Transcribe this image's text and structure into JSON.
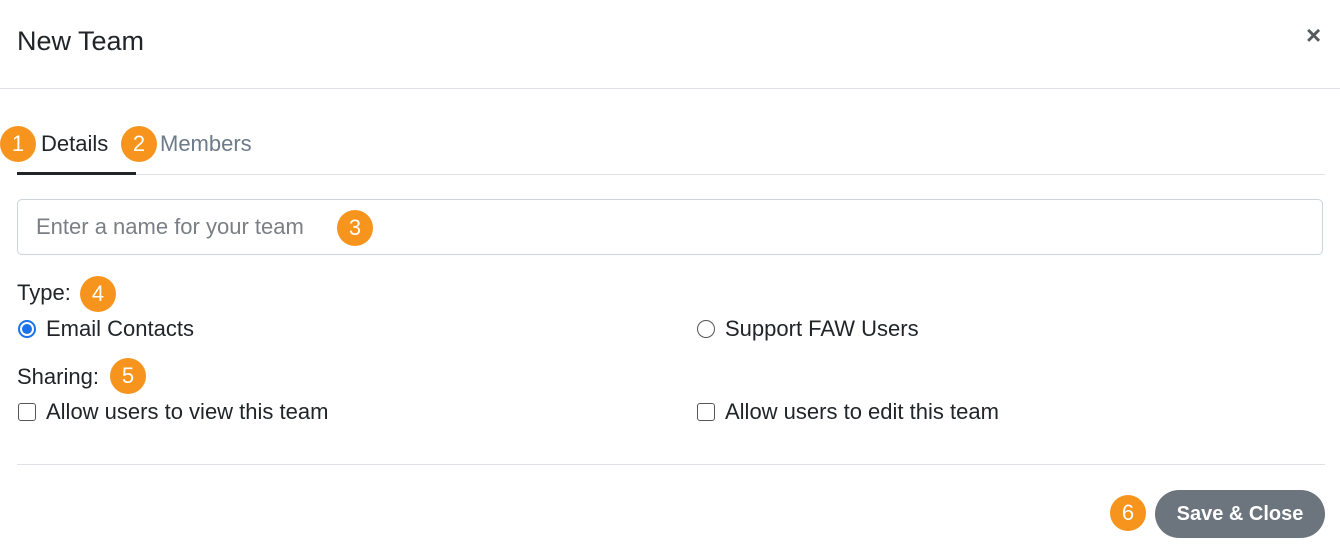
{
  "dialog": {
    "title": "New Team",
    "close_symbol": "×"
  },
  "tabs": [
    {
      "label": "Details",
      "active": true
    },
    {
      "label": "Members",
      "active": false
    }
  ],
  "name_input": {
    "placeholder": "Enter a name for your team",
    "value": ""
  },
  "type": {
    "label": "Type:",
    "options": [
      {
        "label": "Email Contacts",
        "selected": true
      },
      {
        "label": "Support FAW Users",
        "selected": false
      }
    ]
  },
  "sharing": {
    "label": "Sharing:",
    "options": [
      {
        "label": "Allow users to view this team",
        "checked": false
      },
      {
        "label": "Allow users to edit this team",
        "checked": false
      }
    ]
  },
  "footer": {
    "save_label": "Save & Close"
  },
  "markers": [
    "1",
    "2",
    "3",
    "4",
    "5",
    "6"
  ],
  "colors": {
    "marker": "#f7941d",
    "radio_accent": "#1a73e8",
    "button": "#6c757d"
  }
}
